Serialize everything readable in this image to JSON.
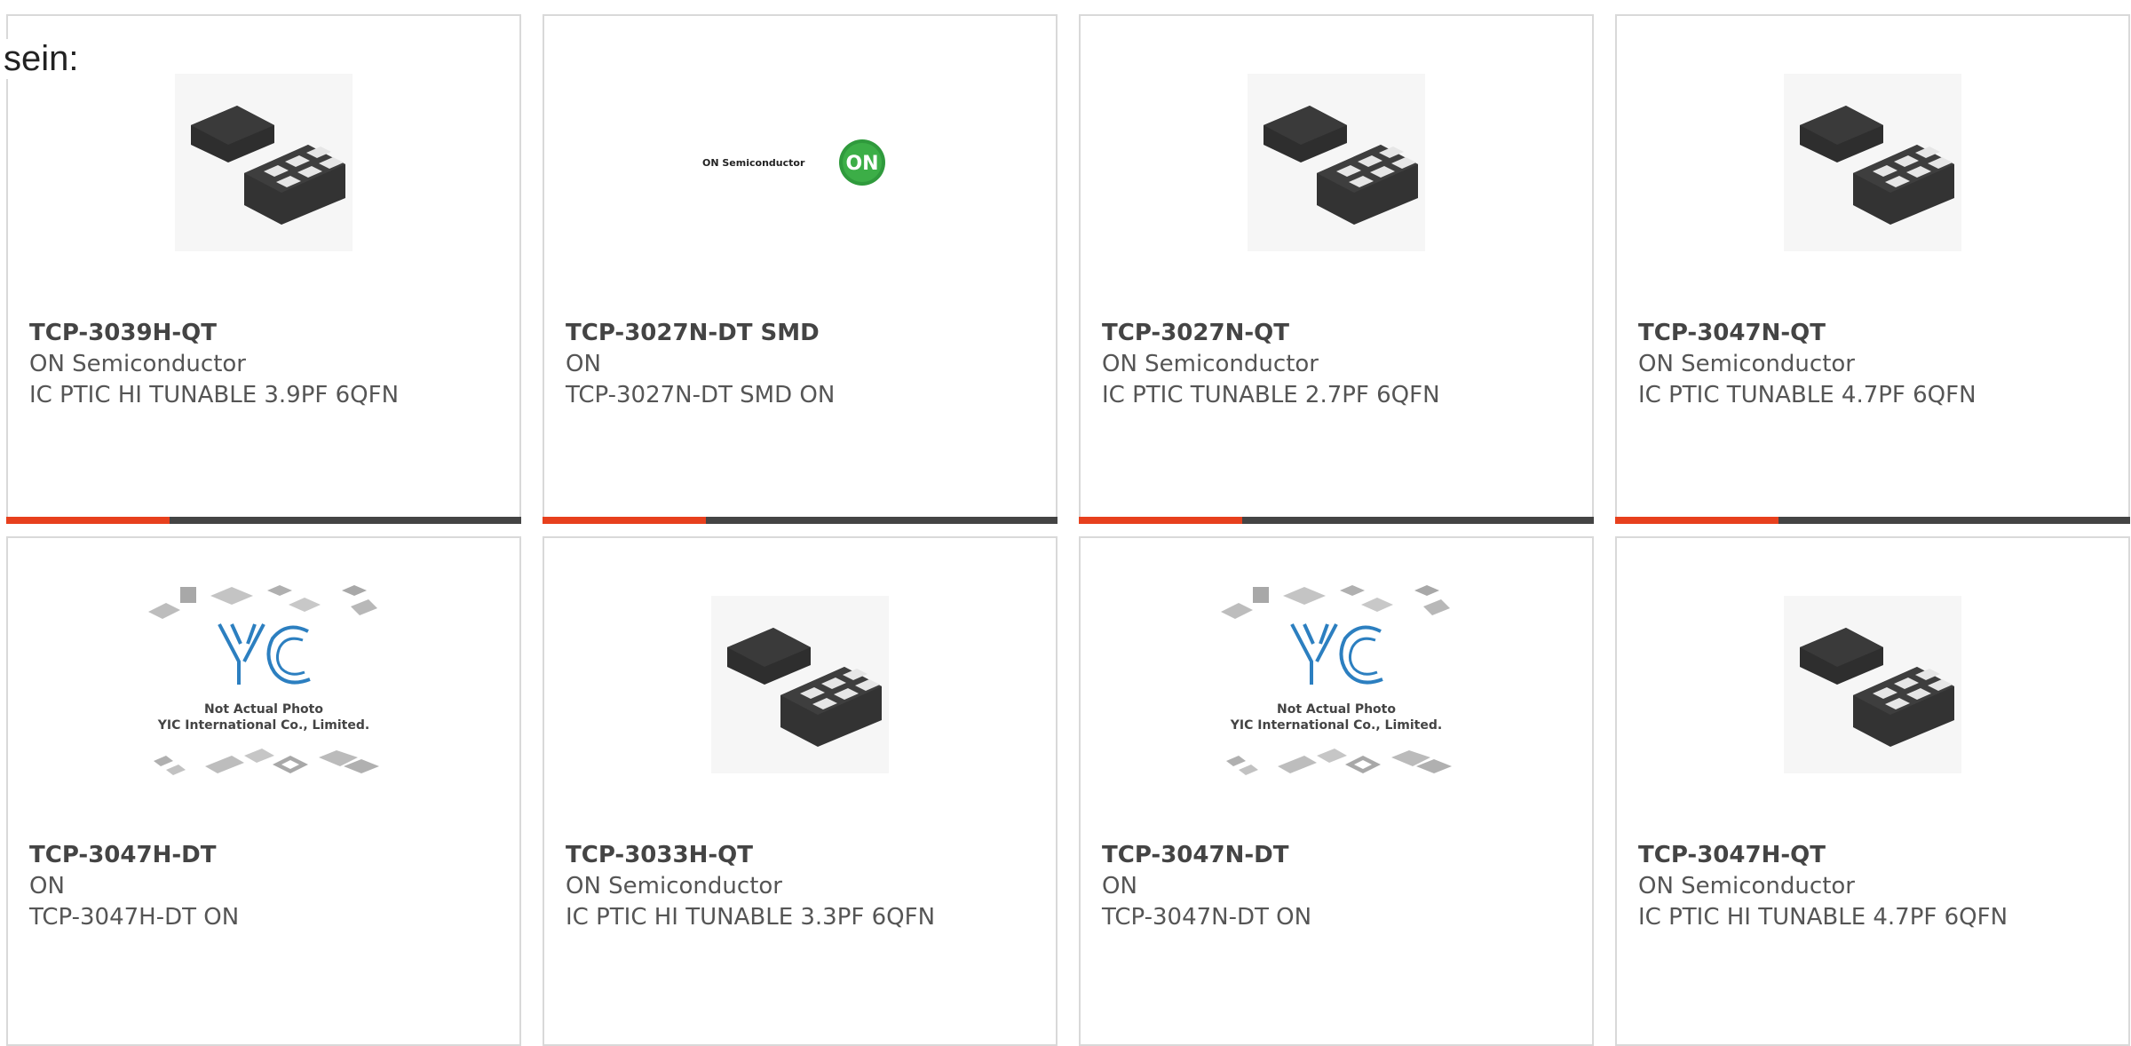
{
  "intro_text": "sein:",
  "accent_color": "#e7401d",
  "bar_color": "#444444",
  "products": [
    {
      "part": "TCP-3039H-QT",
      "manufacturer": "ON Semiconductor",
      "description": "IC PTIC HI TUNABLE 3.9PF 6QFN",
      "image": "qfn-chip"
    },
    {
      "part": "TCP-3027N-DT SMD",
      "manufacturer": "ON",
      "description": "TCP-3027N-DT SMD ON",
      "image": "on-semiconductor-logo",
      "logo_text": "ON Semiconductor",
      "logo_badge": "ON"
    },
    {
      "part": "TCP-3027N-QT",
      "manufacturer": "ON Semiconductor",
      "description": "IC PTIC TUNABLE 2.7PF 6QFN",
      "image": "qfn-chip"
    },
    {
      "part": "TCP-3047N-QT",
      "manufacturer": "ON Semiconductor",
      "description": "IC PTIC TUNABLE 4.7PF 6QFN",
      "image": "qfn-chip"
    },
    {
      "part": "TCP-3047H-DT",
      "manufacturer": "ON",
      "description": "TCP-3047H-DT ON",
      "image": "placeholder-photo",
      "placeholder_line1": "Not Actual Photo",
      "placeholder_line2": "YIC International Co., Limited."
    },
    {
      "part": "TCP-3033H-QT",
      "manufacturer": "ON Semiconductor",
      "description": "IC PTIC HI TUNABLE 3.3PF 6QFN",
      "image": "qfn-chip"
    },
    {
      "part": "TCP-3047N-DT",
      "manufacturer": "ON",
      "description": "TCP-3047N-DT ON",
      "image": "placeholder-photo",
      "placeholder_line1": "Not Actual Photo",
      "placeholder_line2": "YIC International Co., Limited."
    },
    {
      "part": "TCP-3047H-QT",
      "manufacturer": "ON Semiconductor",
      "description": "IC PTIC HI TUNABLE 4.7PF 6QFN",
      "image": "qfn-chip"
    }
  ]
}
